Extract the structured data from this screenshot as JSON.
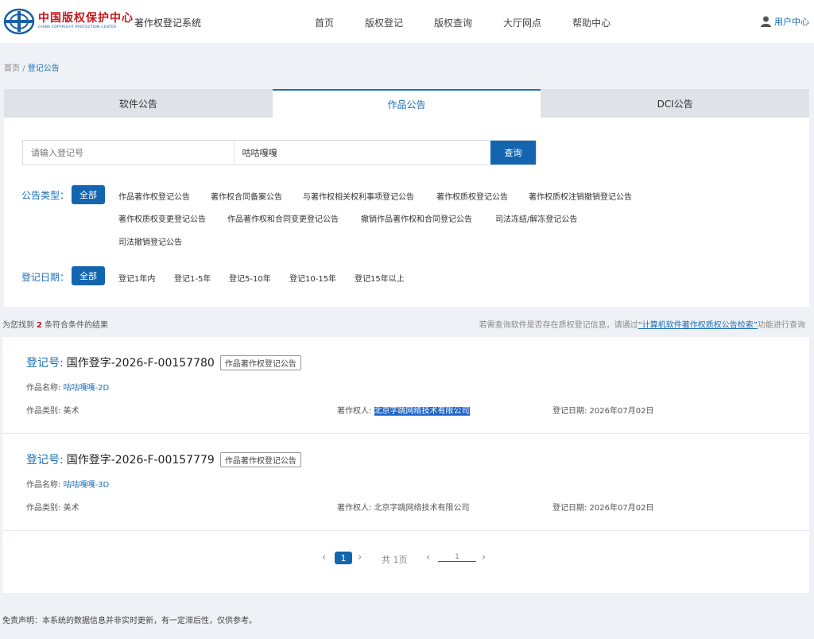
{
  "header": {
    "logo_cn": "中国版权保护中心",
    "logo_en": "CHINA COPYRIGHT PROTECTION CENTER",
    "system_name": "著作权登记系统",
    "nav": [
      "首页",
      "版权登记",
      "版权查询",
      "大厅网点",
      "帮助中心"
    ],
    "user_label": "用户中心"
  },
  "breadcrumb": {
    "home": "首页",
    "sep": "/",
    "current": "登记公告"
  },
  "tabs": [
    {
      "label": "软件公告",
      "active": false
    },
    {
      "label": "作品公告",
      "active": true
    },
    {
      "label": "DCI公告",
      "active": false
    }
  ],
  "search": {
    "reg_placeholder": "请输入登记号",
    "name_value": "咕咕嘎嘎",
    "button": "查询"
  },
  "filters": {
    "type_label": "公告类型：",
    "all_label": "全部",
    "type_options": [
      "作品著作权登记公告",
      "著作权合同备案公告",
      "与著作权相关权利事项登记公告",
      "著作权质权登记公告",
      "著作权质权注销撤销登记公告",
      "著作权质权变更登记公告",
      "作品著作权和合同变更登记公告",
      "撤销作品著作权和合同登记公告",
      "司法冻结/解冻登记公告",
      "司法撤销登记公告"
    ],
    "date_label": "登记日期：",
    "date_options": [
      "登记1年内",
      "登记1-5年",
      "登记5-10年",
      "登记10-15年",
      "登记15年以上"
    ]
  },
  "results": {
    "prefix": "为您找到",
    "count": "2",
    "suffix": "条符合条件的结果",
    "hint_pre": "若需查询软件是否存在质权登记信息，请通过",
    "hint_link": "“计算机软件著作权质权公告检索”",
    "hint_post": "功能进行查询"
  },
  "items": [
    {
      "reg_label": "登记号:",
      "reg_no": "国作登字-2026-F-00157780",
      "tag": "作品著作权登记公告",
      "name_label": "作品名称:",
      "name": "咕咕嘎嘎-2D",
      "category": "作品类别: 美术",
      "owner_label": "著作权人:",
      "owner": "北京字跳网络技术有限公司",
      "date": "登记日期: 2026年07月02日"
    },
    {
      "reg_label": "登记号:",
      "reg_no": "国作登字-2026-F-00157779",
      "tag": "作品著作权登记公告",
      "name_label": "作品名称:",
      "name": "咕咕嘎嘎-3D",
      "category": "作品类别: 美术",
      "owner_label": "著作权人:",
      "owner": "北京字跳网络技术有限公司",
      "date": "登记日期: 2026年07月02日"
    }
  ],
  "pager": {
    "current": "1",
    "total": "共 1页",
    "jump_value": "1"
  },
  "disclaimer": "免责声明：本系统的数据信息并非实时更新，有一定滞后性，仅供参考。",
  "colors": {
    "primary": "#1465b0",
    "link": "#1a6fb8",
    "logo_red": "#c8161d",
    "highlight": "#1e64c8"
  }
}
